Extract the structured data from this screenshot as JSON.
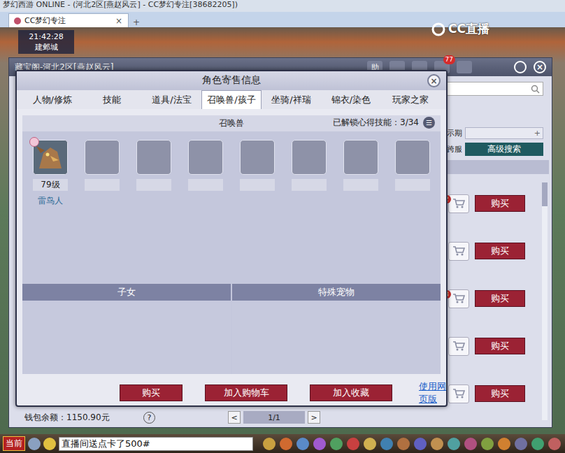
{
  "window": {
    "title": "梦幻西游 ONLINE - (河北2区[燕赵风云] - CC梦幻专注[38682205])"
  },
  "browser_tabs": [
    {
      "label": "CC梦幻专注",
      "close": "×",
      "selected": true
    }
  ],
  "new_tab": "+",
  "hud": {
    "time": "21:42:28",
    "location": "建邺城"
  },
  "watermark": "CC直播",
  "market_window": {
    "title": "藏宝阁-河北2区[燕赵风云]",
    "toolbar": [
      "助"
    ],
    "badge": "77",
    "close": "×",
    "filters": [
      {
        "label": "示期",
        "add": "+"
      },
      {
        "label": "跨服",
        "button": "高级搜索"
      }
    ],
    "listing_rows": [
      {
        "mark": "2",
        "buy": "购买"
      },
      {
        "mark": "",
        "buy": "购买"
      },
      {
        "mark": "3",
        "buy": "购买"
      },
      {
        "mark": "",
        "buy": "购买"
      },
      {
        "mark": "",
        "buy": "购买"
      }
    ],
    "wallet": "钱包余额：1150.90元",
    "help": "?",
    "pager": {
      "prev": "<",
      "page": "1/1",
      "next": ">"
    }
  },
  "dialog": {
    "title": "角色寄售信息",
    "close": "×",
    "tabs": [
      {
        "label": "人物/修炼",
        "selected": false
      },
      {
        "label": "技能",
        "selected": false
      },
      {
        "label": "道具/法宝",
        "selected": false
      },
      {
        "label": "召唤兽/孩子",
        "selected": true
      },
      {
        "label": "坐骑/祥瑞",
        "selected": false
      },
      {
        "label": "锦衣/染色",
        "selected": false
      },
      {
        "label": "玩家之家",
        "selected": false
      }
    ],
    "section": {
      "title": "召唤兽",
      "skills": "已解锁心得技能：3/34",
      "menu": "☰"
    },
    "slots": [
      {
        "filled": true,
        "level": "79级",
        "name": "雷鸟人"
      },
      {
        "filled": false,
        "level": "",
        "name": ""
      },
      {
        "filled": false,
        "level": "",
        "name": ""
      },
      {
        "filled": false,
        "level": "",
        "name": ""
      },
      {
        "filled": false,
        "level": "",
        "name": ""
      },
      {
        "filled": false,
        "level": "",
        "name": ""
      },
      {
        "filled": false,
        "level": "",
        "name": ""
      },
      {
        "filled": false,
        "level": "",
        "name": ""
      }
    ],
    "lower_panels": [
      "子女",
      "特殊宠物"
    ],
    "buttons": [
      "购买",
      "加入购物车",
      "加入收藏"
    ],
    "link": "使用网页版"
  },
  "chat": {
    "channel": "当前",
    "input": "直播间送点卡了500#"
  }
}
